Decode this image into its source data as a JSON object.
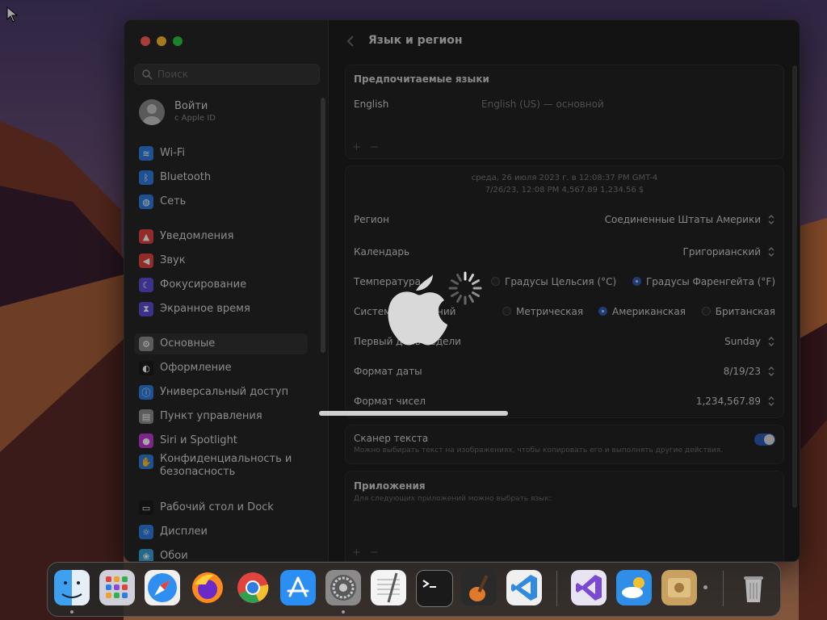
{
  "window": {
    "title": "Язык и регион"
  },
  "sidebar": {
    "search_placeholder": "Поиск",
    "account": {
      "title": "Войти",
      "subtitle": "с Apple ID"
    },
    "items": [
      {
        "label": "Wi‑Fi",
        "icon": "wifi-icon",
        "color": "#2f7de1"
      },
      {
        "label": "Bluetooth",
        "icon": "bluetooth-icon",
        "color": "#2f7de1"
      },
      {
        "label": "Сеть",
        "icon": "globe-icon",
        "color": "#2f7de1"
      },
      {
        "label": "Уведомления",
        "icon": "bell-icon",
        "color": "#e0443e"
      },
      {
        "label": "Звук",
        "icon": "speaker-icon",
        "color": "#e0443e"
      },
      {
        "label": "Фокусирование",
        "icon": "moon-icon",
        "color": "#5b4fd6"
      },
      {
        "label": "Экранное время",
        "icon": "hourglass-icon",
        "color": "#5b4fd6"
      },
      {
        "label": "Основные",
        "icon": "gear-icon",
        "color": "#8e8e8e"
      },
      {
        "label": "Оформление",
        "icon": "appearance-icon",
        "color": "#1c1c1c"
      },
      {
        "label": "Универсальный доступ",
        "icon": "accessibility-icon",
        "color": "#2f7de1"
      },
      {
        "label": "Пункт управления",
        "icon": "control-center-icon",
        "color": "#8e8e8e"
      },
      {
        "label": "Siri и Spotlight",
        "icon": "siri-icon",
        "color": "#c13ad6"
      },
      {
        "label": "Конфиденциальность и безопасность",
        "icon": "hand-icon",
        "color": "#2f7de1"
      },
      {
        "label": "Рабочий стол и Dock",
        "icon": "dock-icon",
        "color": "#1c1c1c"
      },
      {
        "label": "Дисплеи",
        "icon": "display-icon",
        "color": "#2f7de1"
      },
      {
        "label": "Обои",
        "icon": "wallpaper-icon",
        "color": "#3aa0d9"
      }
    ]
  },
  "languages": {
    "header": "Предпочитаемые языки",
    "items": [
      {
        "name": "English",
        "detail": "English (US) — основной"
      }
    ],
    "add": "+",
    "remove": "−"
  },
  "region_group": {
    "preview_line1": "среда, 26 июля 2023 г. в 12:08:37 PM GMT-4",
    "preview_line2": "7/26/23, 12:08 PM     4,567.89     1,234.56 $",
    "region": {
      "label": "Регион",
      "value": "Соединенные Штаты Америки"
    },
    "calendar": {
      "label": "Календарь",
      "value": "Григорианский"
    },
    "temperature": {
      "label": "Температура",
      "opt1": "Градусы Цельсия (°C)",
      "opt2": "Градусы Фаренгейта (°F)"
    },
    "measure": {
      "label": "Система измерений",
      "opt1": "Метрическая",
      "opt2": "Американская",
      "opt3": "Британская"
    },
    "week": {
      "label": "Первый день недели",
      "value": "Sunday"
    },
    "date_format": {
      "label": "Формат даты",
      "value": "8/19/23"
    },
    "number_format": {
      "label": "Формат чисел",
      "value": "1,234,567.89"
    }
  },
  "live_text": {
    "title": "Сканер текста",
    "desc": "Можно выбирать текст на изображениях, чтобы копировать его и выполнять другие действия."
  },
  "apps": {
    "title": "Приложения",
    "desc": "Для следующих приложений можно выбрать язык:",
    "add": "+",
    "remove": "−"
  },
  "dock": {
    "apps": [
      "finder-icon",
      "launchpad-icon",
      "safari-icon",
      "firefox-icon",
      "chrome-icon",
      "app-store-icon",
      "system-settings-icon",
      "textedit-icon",
      "terminal-icon",
      "garageband-icon",
      "vscode-icon",
      "visual-studio-icon",
      "weather-icon",
      "preview-icon",
      "trash-icon"
    ]
  }
}
